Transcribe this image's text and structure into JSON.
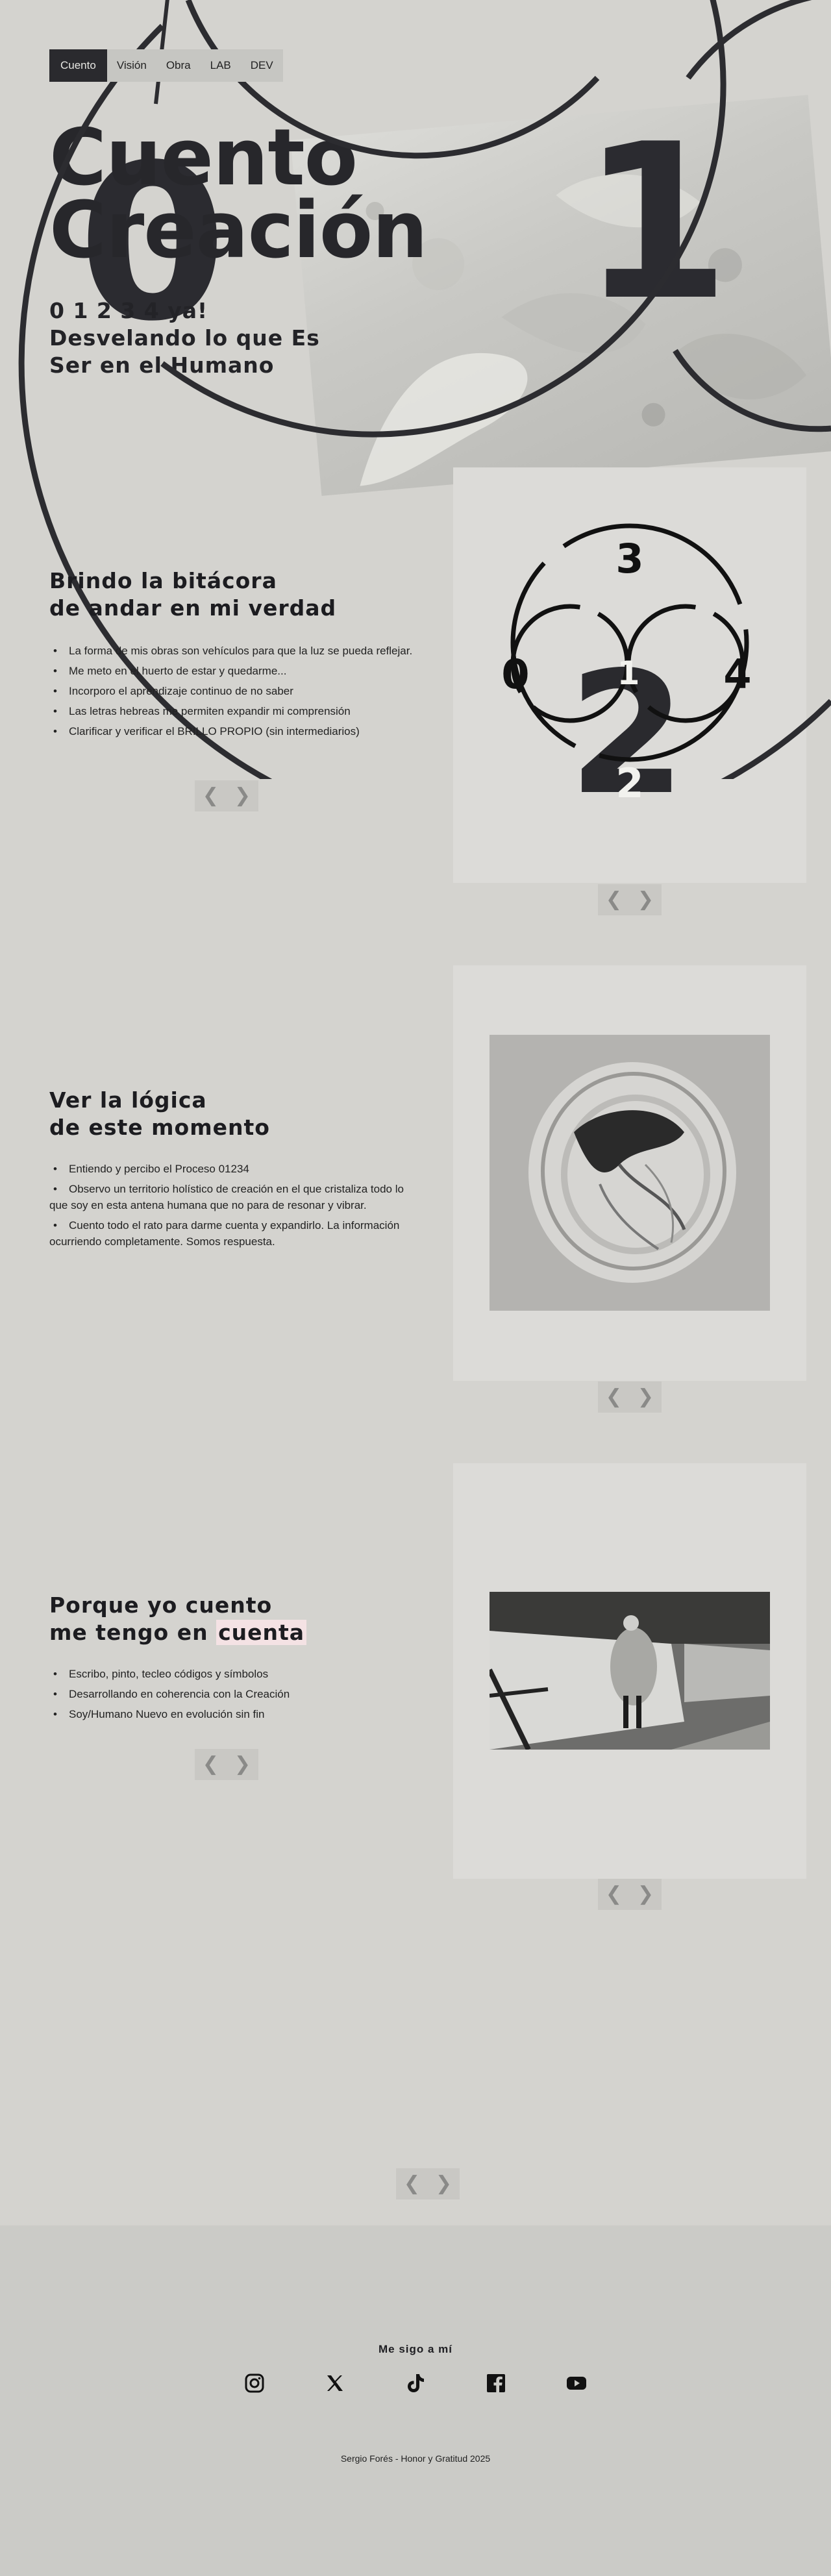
{
  "nav": {
    "items": [
      {
        "label": "Cuento",
        "active": true
      },
      {
        "label": "Visión",
        "active": false
      },
      {
        "label": "Obra",
        "active": false
      },
      {
        "label": "LAB",
        "active": false
      },
      {
        "label": "DEV",
        "active": false
      }
    ]
  },
  "hero": {
    "digit_zero": "0",
    "digit_one": "1",
    "title_line1": "Cuento",
    "title_line2": "Creación",
    "subtitle_line1": "0 1 2 3 4 ya!",
    "subtitle_line2": "Desvelando lo que Es",
    "subtitle_line3": "Ser en el Humano"
  },
  "section1": {
    "title_line1": "Brindo la bitácora",
    "title_line2": "de andar en mi verdad",
    "bullets": [
      "La forma de mis obras son vehículos para que la luz se pueda reflejar.",
      "Me meto en el huerto de estar y quedarme...",
      "Incorporo el aprendizaje continuo de no saber",
      "Las letras hebreas me permiten expandir mi comprensión",
      "Clarificar y verificar el BRILLO PROPIO (sin intermediarios)"
    ],
    "diagram": {
      "big": "2",
      "top": "3",
      "left": "0",
      "center": "1",
      "right": "4",
      "bottom": "2"
    }
  },
  "section2": {
    "title_line1": "Ver la lógica",
    "title_line2": "de este momento",
    "bullets": [
      "Entiendo y percibo el Proceso 01234",
      "Observo un territorio holístico de creación en el que cristaliza todo lo que soy en esta antena humana que no para de resonar y vibrar.",
      "Cuento todo el rato para darme cuenta y expandirlo. La información ocurriendo completamente. Somos respuesta."
    ]
  },
  "section3": {
    "title_line1": "Porque yo cuento",
    "title_line2_pre": "me tengo en ",
    "title_line2_highlight": "cuenta",
    "bullets": [
      "Escribo, pinto, tecleo códigos y símbolos",
      "Desarrollando en coherencia con la Creación",
      "Soy/Humano Nuevo en evolución sin fin"
    ]
  },
  "arrows": {
    "prev": "❮",
    "next": "❯"
  },
  "footer": {
    "follow_label": "Me sigo a mí",
    "socials": [
      "instagram-icon",
      "x-icon",
      "tiktok-icon",
      "facebook-icon",
      "youtube-icon"
    ],
    "copyright": "Sergio Forés - Honor y Gratitud 2025"
  },
  "colors": {
    "background": "#d4d3cf",
    "dark": "#2a2a2e",
    "card": "#dcdbd8",
    "highlight": "#f4e2e4"
  }
}
